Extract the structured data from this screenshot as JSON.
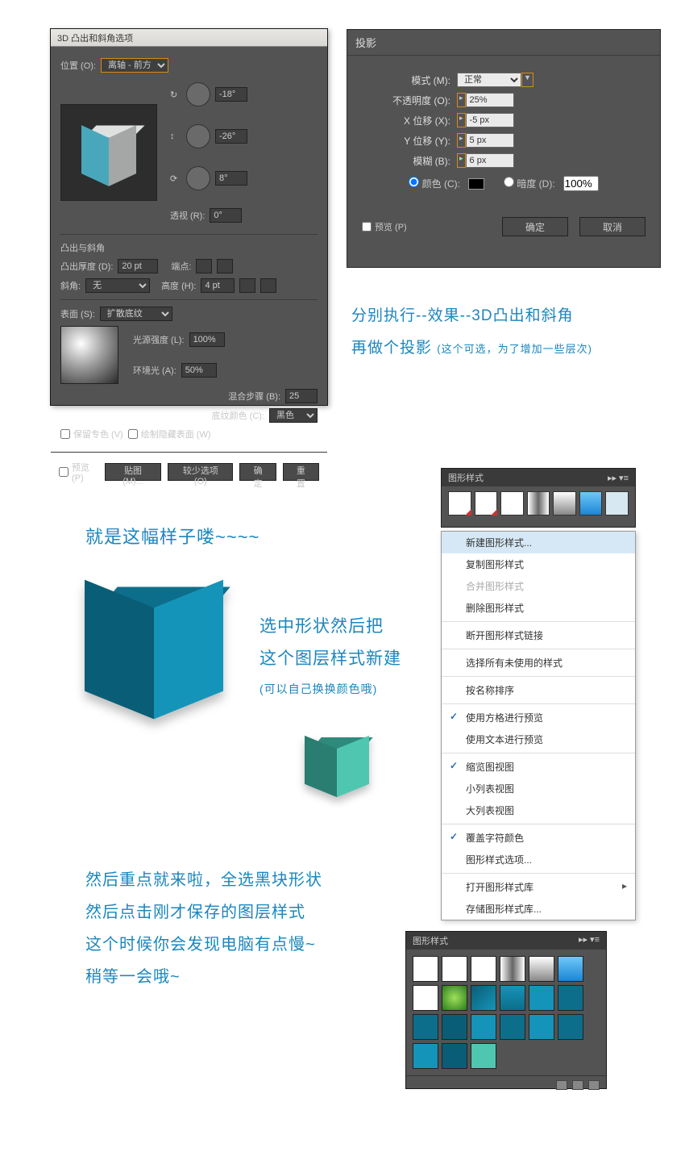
{
  "panel3d": {
    "title": "3D 凸出和斜角选项",
    "position_label": "位置 (O):",
    "position_value": "离轴 - 前方",
    "angle1": "-18°",
    "angle2": "-26°",
    "angle3": "8°",
    "perspective_label": "透视 (R):",
    "perspective_value": "0°",
    "extrude_section": "凸出与斜角",
    "depth_label": "凸出厚度 (D):",
    "depth_value": "20 pt",
    "cap_label": "端点:",
    "bevel_label": "斜角:",
    "bevel_value": "无",
    "height_label": "高度 (H):",
    "height_value": "4 pt",
    "surface_label": "表面 (S):",
    "surface_value": "扩散底纹",
    "light_label": "光源强度 (L):",
    "light_value": "100%",
    "ambient_label": "环境光 (A):",
    "ambient_value": "50%",
    "blend_label": "混合步骤 (B):",
    "blend_value": "25",
    "shade_label": "底纹颜色 (C):",
    "shade_value": "黑色",
    "preserve": "保留专色 (V)",
    "drawhidden": "绘制隐藏表面 (W)",
    "preview": "预览 (P)",
    "btn_map": "贴图 (M)...",
    "btn_less": "较少选项 (O)",
    "btn_ok": "确定",
    "btn_reset": "重置"
  },
  "shadow": {
    "title": "投影",
    "mode_label": "模式 (M):",
    "mode_value": "正常",
    "opacity_label": "不透明度 (O):",
    "opacity_value": "25%",
    "x_label": "X 位移 (X):",
    "x_value": "-5 px",
    "y_label": "Y 位移 (Y):",
    "y_value": "5 px",
    "blur_label": "模糊 (B):",
    "blur_value": "6 px",
    "color_label": "颜色 (C):",
    "dark_label": "暗度 (D):",
    "dark_value": "100%",
    "preview": "预览 (P)",
    "ok": "确定",
    "cancel": "取消"
  },
  "notes": {
    "n1": "分别执行--效果--3D凸出和斜角",
    "n2a": "再做个投影",
    "n2b": "(这个可选，为了增加一些层次)",
    "n3": "就是这幅样子喽~~~~",
    "n4a": "选中形状然后把",
    "n4b": "这个图层样式新建",
    "n4c": "(可以自己换换颜色哦)",
    "n5a": "然后重点就来啦，全选黑块形状",
    "n5b": "然后点击刚才保存的图层样式",
    "n5c": "这个时候你会发现电脑有点慢~",
    "n5d": "稍等一会哦~"
  },
  "gs_strip": {
    "title": "图形样式"
  },
  "ctx_items": [
    {
      "t": "新建图形样式...",
      "hl": true
    },
    {
      "t": "复制图形样式"
    },
    {
      "t": "合并图形样式",
      "dis": true
    },
    {
      "t": "删除图形样式"
    },
    {
      "sep": true
    },
    {
      "t": "断开图形样式链接"
    },
    {
      "sep": true
    },
    {
      "t": "选择所有未使用的样式"
    },
    {
      "sep": true
    },
    {
      "t": "按名称排序"
    },
    {
      "sep": true
    },
    {
      "t": "使用方格进行预览",
      "chk": true
    },
    {
      "t": "使用文本进行预览"
    },
    {
      "sep": true
    },
    {
      "t": "缩览图视图",
      "chk": true
    },
    {
      "t": "小列表视图"
    },
    {
      "t": "大列表视图"
    },
    {
      "sep": true
    },
    {
      "t": "覆盖字符颜色",
      "chk": true
    },
    {
      "t": "图形样式选项..."
    },
    {
      "sep": true
    },
    {
      "t": "打开图形样式库",
      "arrow": true
    },
    {
      "t": "存储图形样式库..."
    }
  ],
  "gs_big": {
    "title": "图形样式"
  },
  "swatches_big": [
    {
      "bg": "#fff"
    },
    {
      "bg": "#fff",
      "corner": true
    },
    {
      "bg": "#fff"
    },
    {
      "bg": "linear-gradient(90deg,#fff,#666,#fff)"
    },
    {
      "bg": "linear-gradient(#fff,#888)"
    },
    {
      "bg": "linear-gradient(#6fc8f7,#1b86d6)"
    },
    {
      "bg": "#fff"
    },
    {
      "bg": "radial-gradient(#9fe05b,#2a7d1b)"
    },
    {
      "bg": "linear-gradient(135deg,#0a5d76,#1594b9)"
    },
    {
      "bg": "linear-gradient(#1594b9,#0c6e8b)"
    },
    {
      "bg": "#1594b9"
    },
    {
      "bg": "#0c6e8b"
    },
    {
      "bg": "#0c6e8b"
    },
    {
      "bg": "#0a5d76"
    },
    {
      "bg": "#1594b9"
    },
    {
      "bg": "#0c6e8b"
    },
    {
      "bg": "#1594b9"
    },
    {
      "bg": "#0c6e8b"
    },
    {
      "bg": "#1594b9"
    },
    {
      "bg": "#0a5d76"
    },
    {
      "bg": "#4fc7b0"
    }
  ]
}
